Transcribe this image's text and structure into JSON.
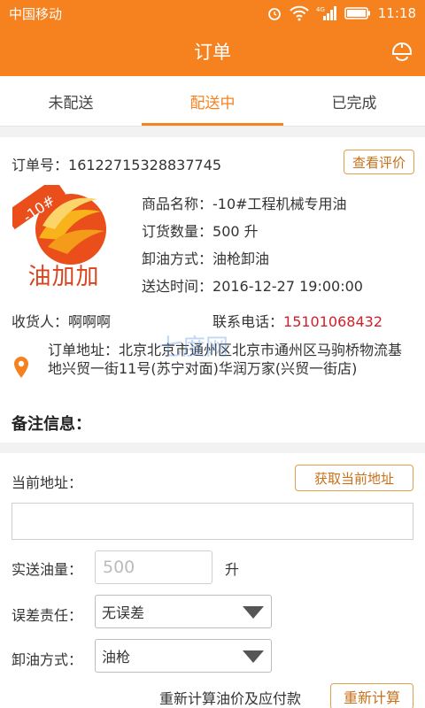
{
  "status": {
    "carrier": "中国移动",
    "time": "11:18",
    "network": "4G"
  },
  "appbar": {
    "title": "订单"
  },
  "tabs": [
    {
      "label": "未配送",
      "active": false
    },
    {
      "label": "配送中",
      "active": true
    },
    {
      "label": "已完成",
      "active": false
    }
  ],
  "order": {
    "number_label": "订单号：",
    "number": "16122715328837745",
    "review_button": "查看评价",
    "logo": {
      "text": "油加加",
      "badge": "-10#"
    },
    "product_label": "商品名称：",
    "product": "-10#工程机械专用油",
    "qty_label": "订货数量：",
    "qty": "500 升",
    "unload_label": "卸油方式：",
    "unload": "油枪卸油",
    "deliver_label": "送达时间：",
    "deliver_time": "2016-12-27 19:00:00",
    "receiver_label": "收货人：",
    "receiver": "啊啊啊",
    "phone_label": "联系电话：",
    "phone": "15101068432",
    "address_label": "订单地址：",
    "address": "北京北京市通州区北京市通州区马驹桥物流基地兴贸一街11号(苏宁对面)华润万家(兴贸一街店)",
    "remark_label": "备注信息："
  },
  "delivery": {
    "current_address_label": "当前地址：",
    "get_address_button": "获取当前地址",
    "address_value": "",
    "actual_qty_label": "实送油量：",
    "actual_qty_placeholder": "500",
    "unit": "升",
    "error_label": "误差责任：",
    "error_value": "无误差",
    "unload_label": "卸油方式：",
    "unload_value": "油枪",
    "recalc_text": "重新计算油价及应付款",
    "recalc_button": "重新计算"
  },
  "watermark": "七度网",
  "colors": {
    "accent": "#f5821f",
    "phone": "#d0202a",
    "button_border": "#e0a04f"
  }
}
